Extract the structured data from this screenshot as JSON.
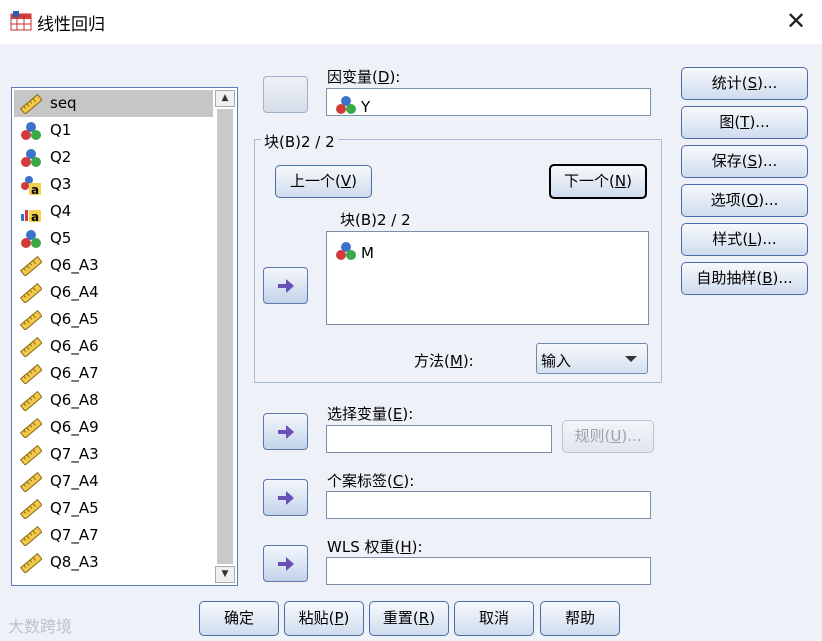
{
  "window": {
    "title": "线性回归",
    "close_glyph": "✕"
  },
  "variables": [
    {
      "name": "seq",
      "icon": "ruler-icon",
      "selected": true
    },
    {
      "name": "Q1",
      "icon": "nominal-icon"
    },
    {
      "name": "Q2",
      "icon": "nominal-icon"
    },
    {
      "name": "Q3",
      "icon": "nominal-string-icon"
    },
    {
      "name": "Q4",
      "icon": "ordinal-string-icon"
    },
    {
      "name": "Q5",
      "icon": "nominal-icon"
    },
    {
      "name": "Q6_A3",
      "icon": "ruler-icon"
    },
    {
      "name": "Q6_A4",
      "icon": "ruler-icon"
    },
    {
      "name": "Q6_A5",
      "icon": "ruler-icon"
    },
    {
      "name": "Q6_A6",
      "icon": "ruler-icon"
    },
    {
      "name": "Q6_A7",
      "icon": "ruler-icon"
    },
    {
      "name": "Q6_A8",
      "icon": "ruler-icon"
    },
    {
      "name": "Q6_A9",
      "icon": "ruler-icon"
    },
    {
      "name": "Q7_A3",
      "icon": "ruler-icon"
    },
    {
      "name": "Q7_A4",
      "icon": "ruler-icon"
    },
    {
      "name": "Q7_A5",
      "icon": "ruler-icon"
    },
    {
      "name": "Q7_A7",
      "icon": "ruler-icon"
    },
    {
      "name": "Q8_A3",
      "icon": "ruler-icon"
    }
  ],
  "dependent": {
    "label": "因变量",
    "mnemonic": "D",
    "value": "Y",
    "icon": "nominal-icon"
  },
  "block": {
    "title": "块(B)2 / 2",
    "prev_label": "上一个",
    "prev_mnemonic": "V",
    "next_label": "下一个",
    "next_mnemonic": "N",
    "inner_label": "块(B)2 / 2",
    "items": [
      {
        "name": "M",
        "icon": "nominal-icon"
      }
    ],
    "method_label": "方法",
    "method_mnemonic": "M",
    "method_value": "输入"
  },
  "selection": {
    "label": "选择变量",
    "mnemonic": "E",
    "rule_label": "规则",
    "rule_mnemonic": "U",
    "rule_suffix": "..."
  },
  "case_label": {
    "label": "个案标签",
    "mnemonic": "C"
  },
  "wls": {
    "label": "WLS 权重",
    "mnemonic": "H"
  },
  "side_buttons": [
    {
      "text": "统计",
      "m": "S",
      "suffix": "..."
    },
    {
      "text": "图",
      "m": "T",
      "suffix": "..."
    },
    {
      "text": "保存",
      "m": "S",
      "suffix": "..."
    },
    {
      "text": "选项",
      "m": "O",
      "suffix": "..."
    },
    {
      "text": "样式",
      "m": "L",
      "suffix": "..."
    },
    {
      "text": "自助抽样",
      "m": "B",
      "suffix": "..."
    }
  ],
  "bottom_buttons": [
    {
      "text": "确定",
      "m": "",
      "suffix": ""
    },
    {
      "text": "粘贴",
      "m": "P",
      "suffix": ""
    },
    {
      "text": "重置",
      "m": "R",
      "suffix": ""
    },
    {
      "text": "取消",
      "m": "",
      "suffix": ""
    },
    {
      "text": "帮助",
      "m": "",
      "suffix": ""
    }
  ],
  "watermark": "大数跨境",
  "colors": {
    "accent": "#4a6da8",
    "arrow": "#6a4fb8",
    "background": "#eef2f8"
  }
}
